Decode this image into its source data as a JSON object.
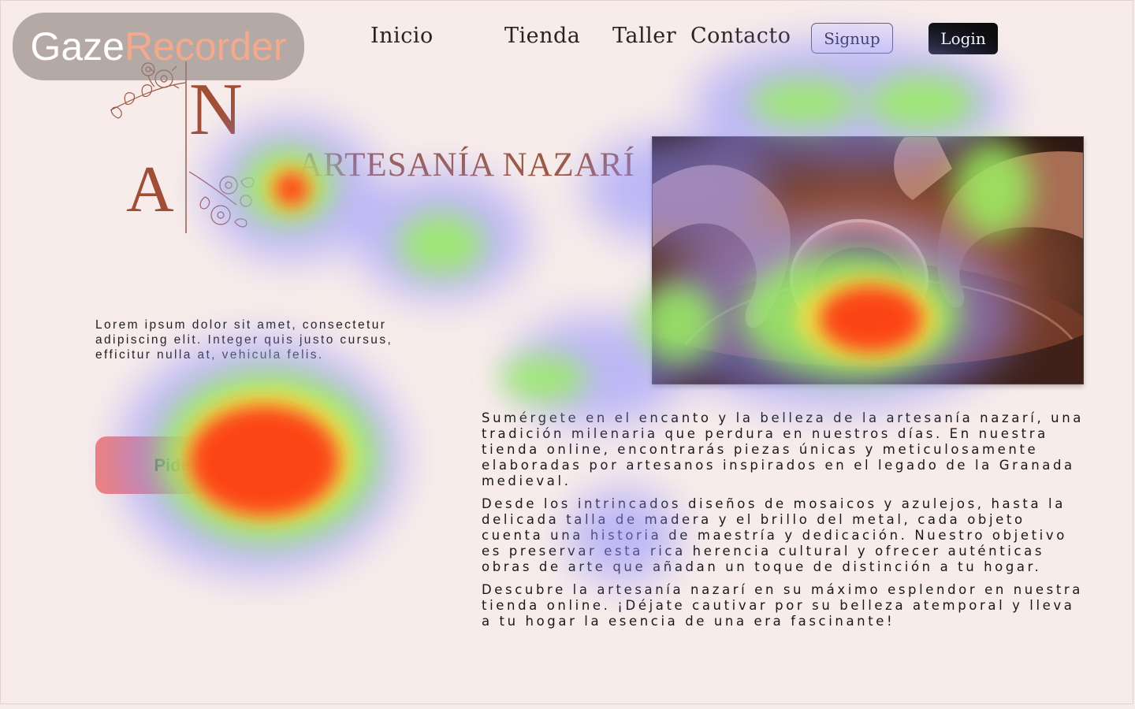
{
  "nav": {
    "inicio": "Inicio",
    "tienda": "Tienda",
    "taller": "Taller",
    "contacto": "Contacto",
    "signup": "Signup",
    "login": "Login"
  },
  "brand": {
    "logo_letter_top": "N",
    "logo_letter_bottom": "A",
    "title": "ARTESANÍA NAZARÍ",
    "accent_color": "#9a5a48"
  },
  "intro": "Lorem ipsum dolor sit amet, consectetur adipiscing elit. Integer quis justo cursus, efficitur nulla at, vehicula felis.",
  "cta": {
    "label": "Pide tu cita",
    "color": "#f0807b"
  },
  "hero_image": {
    "icon": "pottery-wheel-hands-image"
  },
  "body": {
    "p1": "Sumérgete en el encanto y la belleza de la artesanía nazarí, una tradición milenaria que perdura en nuestros días. En nuestra tienda online, encontrarás piezas únicas y meticulosamente elaboradas por artesanos inspirados en el legado de la Granada medieval.",
    "p2": "Desde los intrincados diseños de mosaicos y azulejos, hasta la delicada talla de madera y el brillo del metal, cada objeto cuenta una historia de maestría y dedicación. Nuestro objetivo es preservar esta rica herencia cultural y ofrecer auténticas obras de arte que añadan un toque de distinción a tu hogar.",
    "p3": "Descubre la artesanía nazarí en su máximo esplendor en nuestra tienda online. ¡Déjate cautivar por su belleza atemporal y lleva a tu hogar la esencia de una era fascinante!"
  },
  "watermark": {
    "part1": "Gaze",
    "part2": "Recorder"
  },
  "colors": {
    "background": "#f8ecea",
    "heat_high": "#ff2a10",
    "heat_mid": "#9af060",
    "heat_low": "#8c8cff"
  }
}
